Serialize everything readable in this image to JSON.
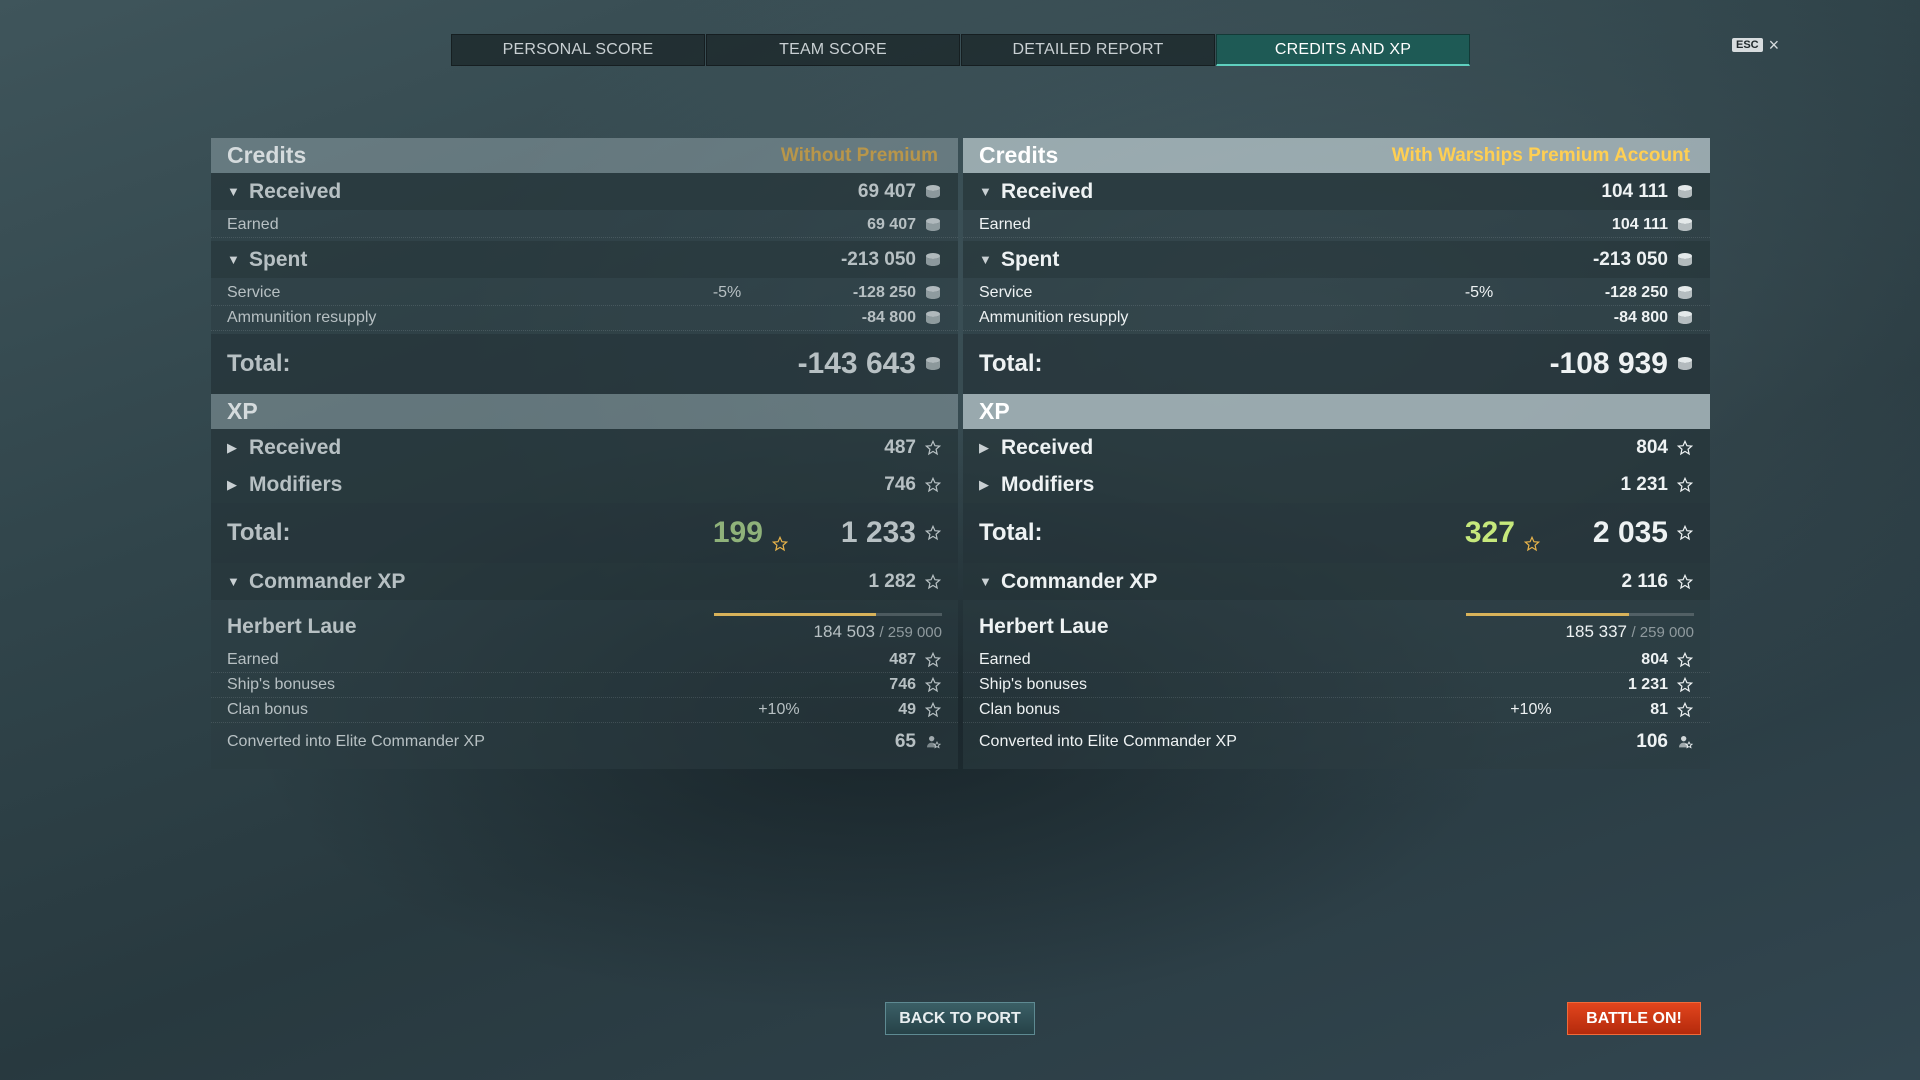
{
  "tabs": [
    {
      "label": "PERSONAL SCORE",
      "active": false
    },
    {
      "label": "TEAM SCORE",
      "active": false
    },
    {
      "label": "DETAILED REPORT",
      "active": false
    },
    {
      "label": "CREDITS AND XP",
      "active": true
    }
  ],
  "esc": {
    "key": "ESC",
    "close": "×"
  },
  "left": {
    "credits_title": "Credits",
    "subtitle": "Without Premium",
    "received": {
      "label": "Received",
      "value": "69 407"
    },
    "earned": {
      "label": "Earned",
      "value": "69 407"
    },
    "spent": {
      "label": "Spent",
      "value": "-213 050"
    },
    "service": {
      "label": "Service",
      "pct": "-5%",
      "value": "-128 250"
    },
    "ammo": {
      "label": "Ammunition resupply",
      "value": "-84 800"
    },
    "credits_total": {
      "label": "Total:",
      "value": "-143 643"
    },
    "xp_title": "XP",
    "xp_received": {
      "label": "Received",
      "value": "487"
    },
    "xp_modifiers": {
      "label": "Modifiers",
      "value": "746"
    },
    "xp_total": {
      "label": "Total:",
      "free": "199",
      "value": "1 233"
    },
    "cmd": {
      "label": "Commander XP",
      "value": "1 282",
      "name": "Herbert Laue",
      "progress": "184 503",
      "max": "/ 259 000",
      "progress_fraction": 0.712,
      "earned": {
        "label": "Earned",
        "value": "487"
      },
      "ship": {
        "label": "Ship's bonuses",
        "value": "746"
      },
      "clan": {
        "label": "Clan bonus",
        "pct": "+10%",
        "value": "49"
      },
      "converted": {
        "label": "Converted into Elite Commander XP",
        "value": "65"
      }
    }
  },
  "right": {
    "credits_title": "Credits",
    "subtitle": "With Warships Premium Account",
    "received": {
      "label": "Received",
      "value": "104 111"
    },
    "earned": {
      "label": "Earned",
      "value": "104 111"
    },
    "spent": {
      "label": "Spent",
      "value": "-213 050"
    },
    "service": {
      "label": "Service",
      "pct": "-5%",
      "value": "-128 250"
    },
    "ammo": {
      "label": "Ammunition resupply",
      "value": "-84 800"
    },
    "credits_total": {
      "label": "Total:",
      "value": "-108 939"
    },
    "xp_title": "XP",
    "xp_received": {
      "label": "Received",
      "value": "804"
    },
    "xp_modifiers": {
      "label": "Modifiers",
      "value": "1 231"
    },
    "xp_total": {
      "label": "Total:",
      "free": "327",
      "value": "2 035"
    },
    "cmd": {
      "label": "Commander XP",
      "value": "2 116",
      "name": "Herbert Laue",
      "progress": "185 337",
      "max": "/ 259 000",
      "progress_fraction": 0.716,
      "earned": {
        "label": "Earned",
        "value": "804"
      },
      "ship": {
        "label": "Ship's bonuses",
        "value": "1 231"
      },
      "clan": {
        "label": "Clan bonus",
        "pct": "+10%",
        "value": "81"
      },
      "converted": {
        "label": "Converted into Elite Commander XP",
        "value": "106"
      }
    }
  },
  "buttons": {
    "back": "BACK TO PORT",
    "battle": "BATTLE ON!"
  },
  "colors": {
    "accent_tab": "#1e5a55",
    "premium": "#ffcf52",
    "free_xp": "#c6e87c",
    "battle": "#d63a14"
  }
}
